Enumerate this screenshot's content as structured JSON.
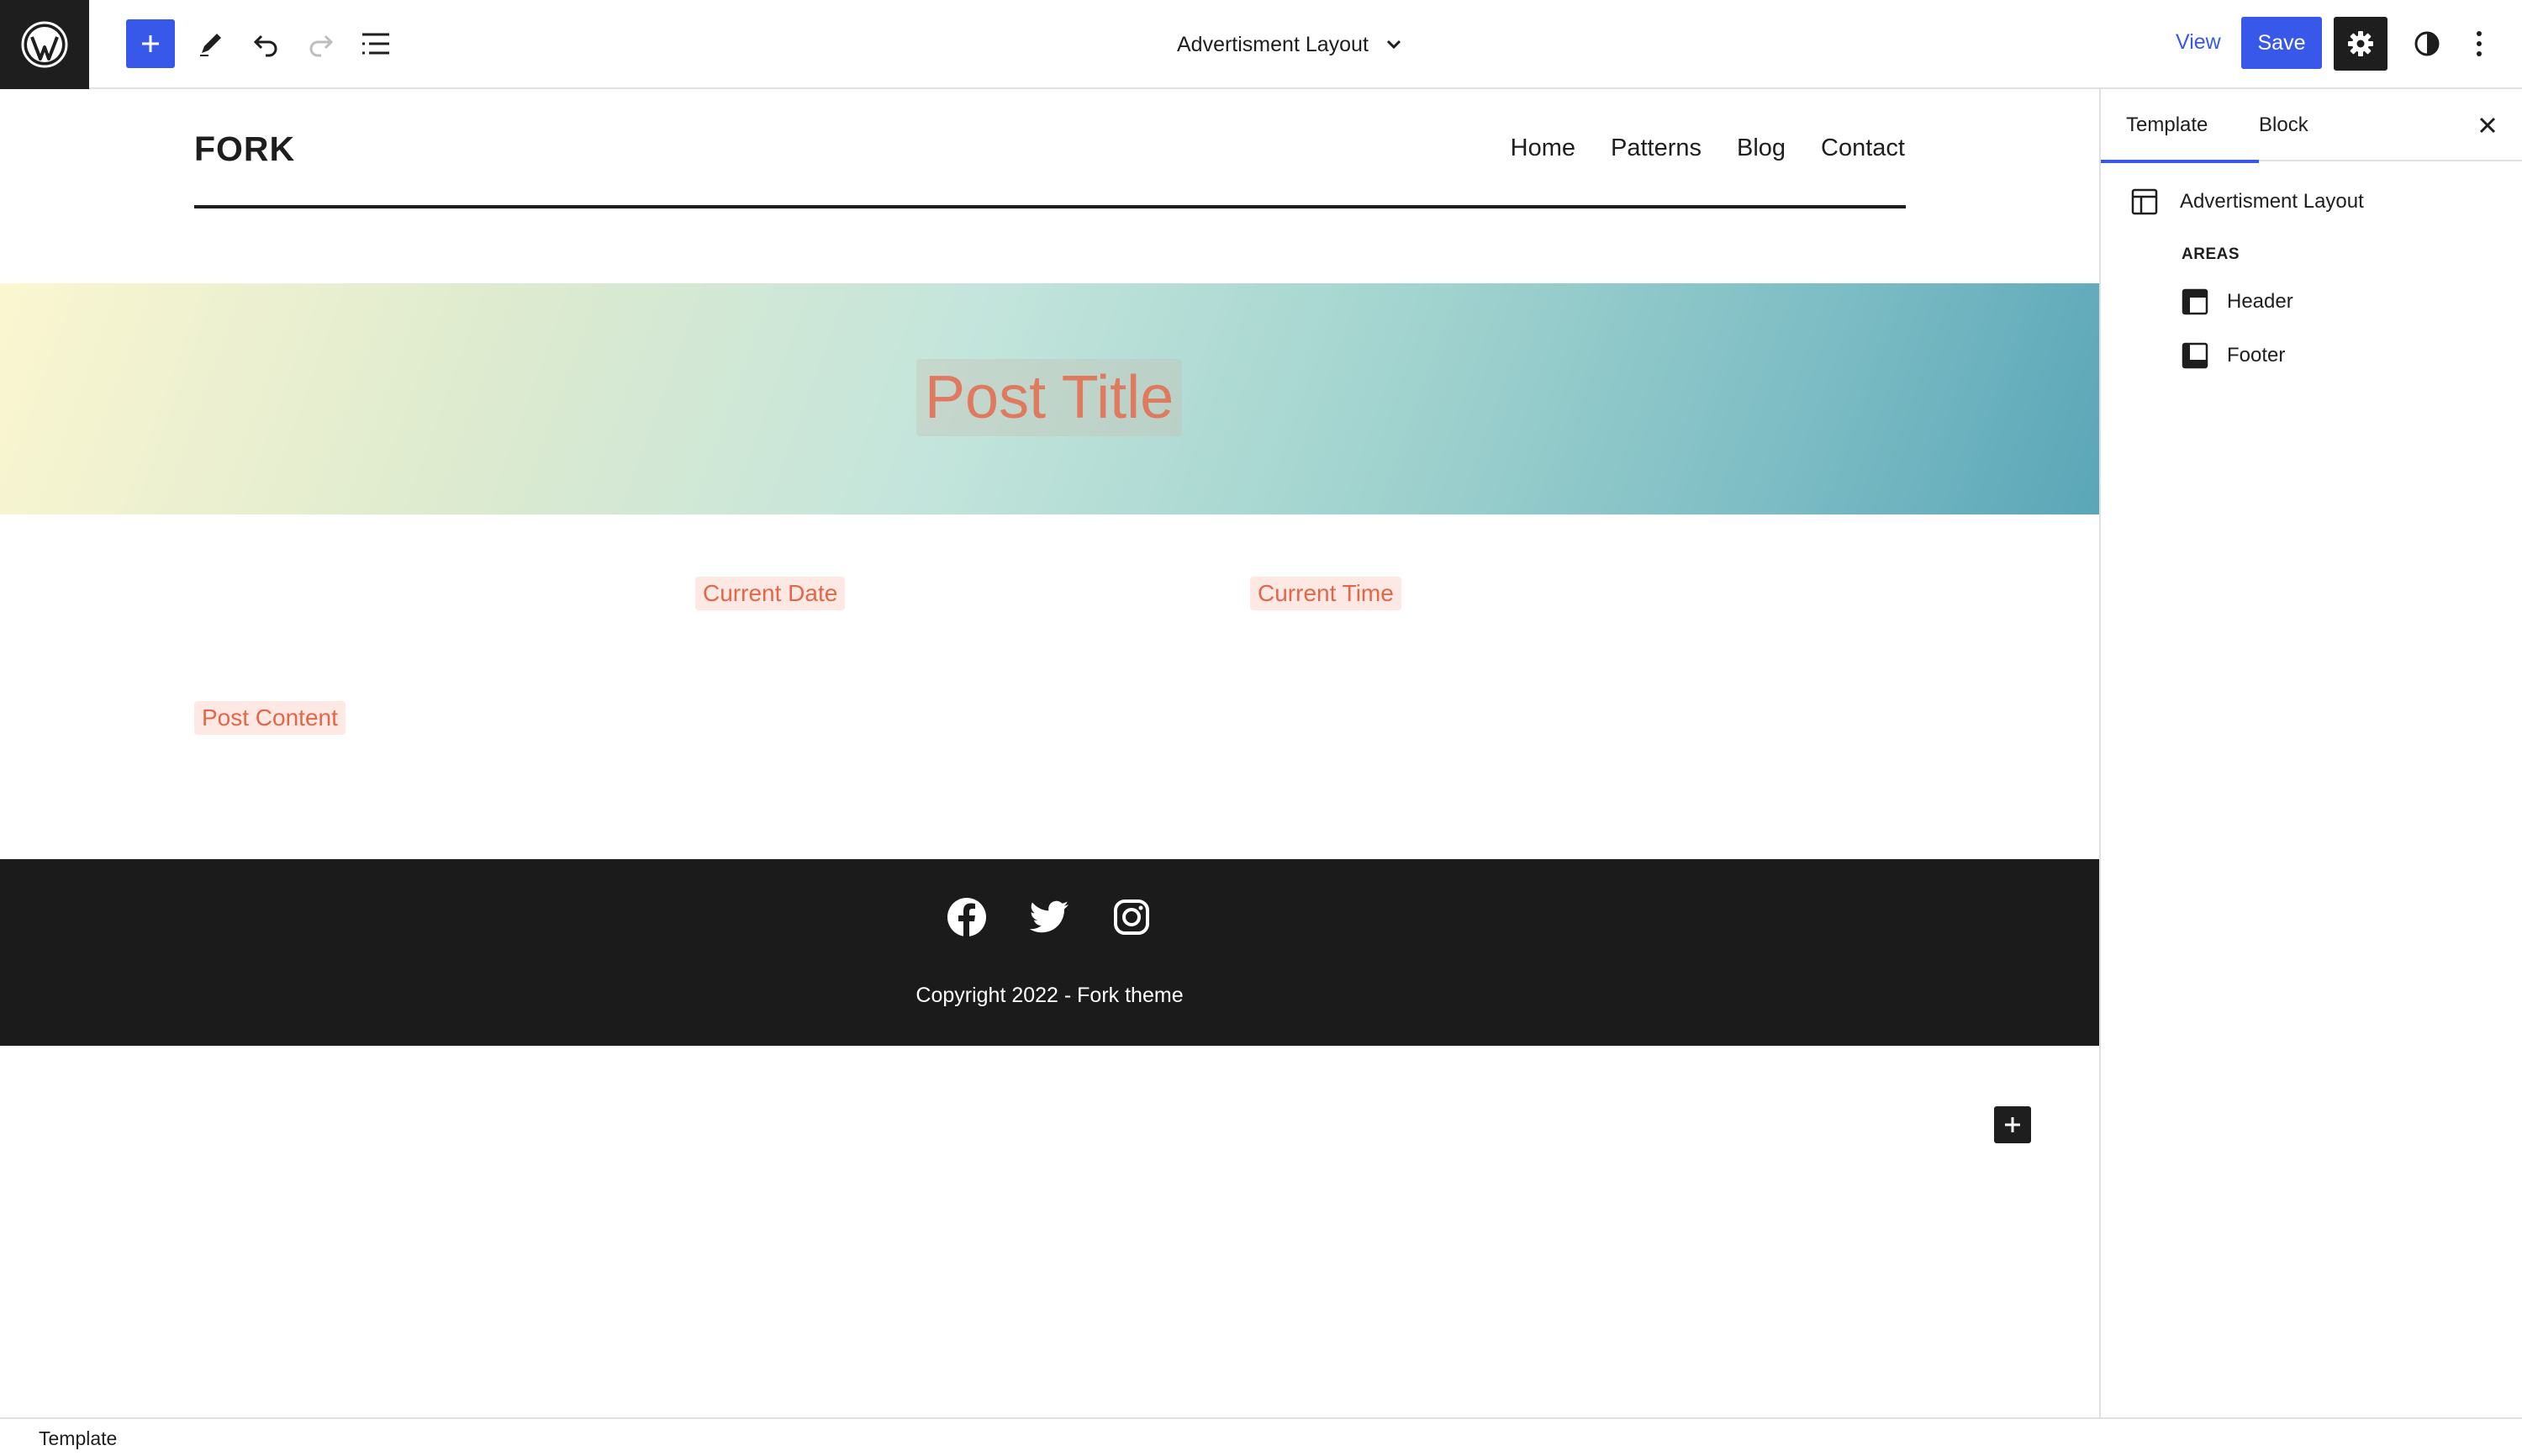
{
  "toolbar": {
    "document_title": "Advertisment Layout",
    "view_label": "View",
    "save_label": "Save",
    "icons": {
      "logo": "wordpress-logo-icon",
      "add": "plus-icon",
      "edit": "pencil-icon",
      "undo": "undo-icon",
      "redo": "redo-icon",
      "list_view": "list-view-icon",
      "dropdown": "chevron-down-icon",
      "settings": "gear-icon",
      "styles": "half-circle-icon",
      "options": "vertical-ellipsis-icon"
    }
  },
  "canvas": {
    "site_title": "FORK",
    "nav": [
      "Home",
      "Patterns",
      "Blog",
      "Contact"
    ],
    "post_title": "Post Title",
    "current_date": "Current Date",
    "current_time": "Current Time",
    "post_content": "Post Content",
    "footer": {
      "social_icons": [
        "facebook-icon",
        "twitter-icon",
        "instagram-icon"
      ],
      "copyright": "Copyright 2022 - Fork theme"
    },
    "accent_color": "#e07a5f"
  },
  "sidebar": {
    "tabs": [
      "Template",
      "Block"
    ],
    "active_tab": "Template",
    "template_name": "Advertisment Layout",
    "areas_heading": "AREAS",
    "areas": [
      "Header",
      "Footer"
    ]
  },
  "status": {
    "breadcrumb": "Template"
  },
  "colors": {
    "primary": "#3858e9",
    "dark": "#1e1e1e",
    "footer_bg": "#1b1b1b"
  }
}
